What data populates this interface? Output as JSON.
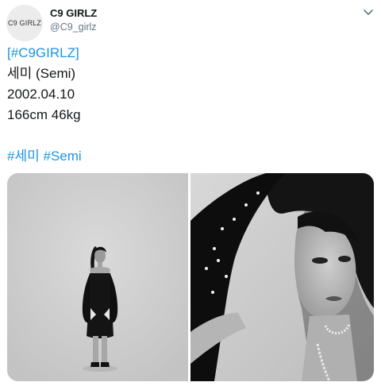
{
  "profile": {
    "avatar_text": "C9 GIRLZ",
    "display_name": "C9 GIRLZ",
    "handle": "@C9_girlz"
  },
  "tweet": {
    "bracket_open": "[",
    "hashtag_group": "#C9GIRLZ",
    "bracket_close": "]",
    "line2": "세미 (Semi)",
    "line3": "2002.04.10",
    "line4": "166cm 46kg",
    "hashtag1": "#세미",
    "hashtag2": "#Semi"
  },
  "media": {
    "photo_left": "full-body black and white photo",
    "photo_right": "close-up black and white portrait"
  },
  "colors": {
    "link": "#1b95e0",
    "text": "#14171a",
    "secondary": "#657786"
  }
}
